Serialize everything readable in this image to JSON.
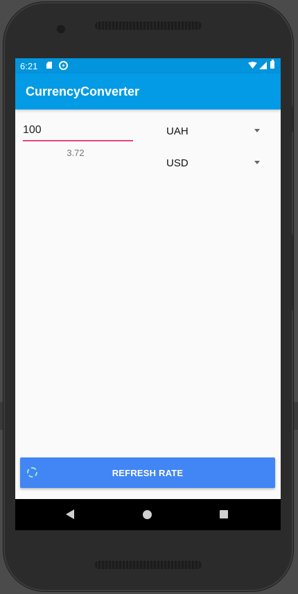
{
  "status_bar": {
    "time": "6:21",
    "icons": [
      "sd-card-icon",
      "sync-icon",
      "wifi-icon",
      "signal-icon",
      "battery-icon"
    ]
  },
  "app_bar": {
    "title": "CurrencyConverter"
  },
  "converter": {
    "amount_value": "100",
    "result": "3.72",
    "from_currency": "UAH",
    "to_currency": "USD"
  },
  "actions": {
    "refresh_label": "REFRESH RATE",
    "loading_icon": "loading-spinner-icon"
  },
  "navigation": {
    "icons": [
      "back-icon",
      "home-icon",
      "recents-icon"
    ]
  },
  "colors": {
    "app_bar": "#039be5",
    "status_bar": "#0294dc",
    "input_underline": "#e9447a",
    "refresh_button": "#4285f4",
    "screen_background": "#fafafa",
    "loading_indicator": "#a8e6c8"
  }
}
